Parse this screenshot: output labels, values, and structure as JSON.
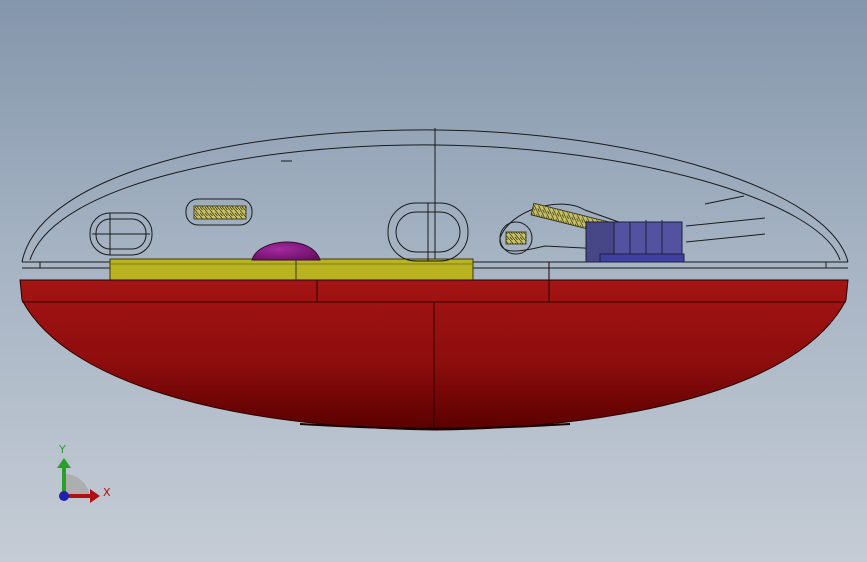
{
  "viewport": {
    "background_top": "#8496ab",
    "background_bottom": "#c5ccd5"
  },
  "model": {
    "bottom_shell_color": "#9b0f0f",
    "bottom_shell_shadow": "#5e0000",
    "pcb_color": "#b8b31f",
    "button_dome_color": "#8a1b86",
    "connector_color": "#4a4a8c",
    "wire_color": "#222222"
  },
  "triad": {
    "y_label": "Y",
    "x_label": "X",
    "y_color": "#2aa02a",
    "x_color": "#b01010",
    "z_color": "#2020b0",
    "icon": "view-orientation-triad-icon"
  }
}
